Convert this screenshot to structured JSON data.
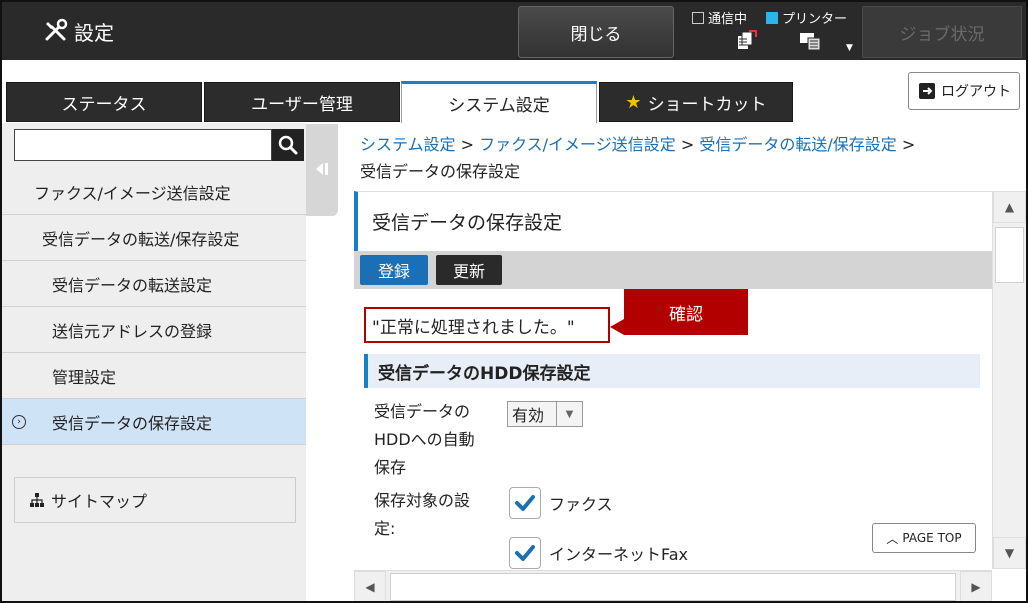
{
  "header": {
    "title": "設定",
    "close_label": "閉じる",
    "status_comm_label": "通信中",
    "status_printer_label": "プリンター",
    "job_status_label": "ジョブ状況"
  },
  "tabs": [
    {
      "label": "ステータス"
    },
    {
      "label": "ユーザー管理"
    },
    {
      "label": "システム設定"
    },
    {
      "label": "ショートカット"
    }
  ],
  "logout_label": "ログアウト",
  "sidebar": {
    "search_value": "",
    "items": [
      {
        "label": "ファクス/イメージ送信設定"
      },
      {
        "label": "受信データの転送/保存設定"
      },
      {
        "label": "受信データの転送設定"
      },
      {
        "label": "送信元アドレスの登録"
      },
      {
        "label": "管理設定"
      },
      {
        "label": "受信データの保存設定"
      }
    ],
    "sitemap_label": "サイトマップ"
  },
  "breadcrumb": {
    "link1": "システム設定",
    "link2": "ファクス/イメージ送信設定",
    "link3": "受信データの転送/保存設定",
    "sep": ">",
    "current": "受信データの保存設定"
  },
  "page": {
    "title": "受信データの保存設定",
    "register_label": "登録",
    "update_label": "更新",
    "message": "\"正常に処理されました。\"",
    "callout_label": "確認",
    "section_title": "受信データのHDD保存設定",
    "auto_save_label_line1": "受信データの",
    "auto_save_label_line2": "HDDへの自動",
    "auto_save_label_line3": "保存",
    "auto_save_value": "有効",
    "target_label_line1": "保存対象の設",
    "target_label_line2": "定:",
    "target_fax_label": "ファクス",
    "target_inet_fax_label": "インターネットFax",
    "page_top_label": "PAGE TOP"
  },
  "colors": {
    "accent": "#1a7fc4",
    "callout": "#b20000",
    "printer_status": "#2bb6e8",
    "star": "#f2c200"
  }
}
